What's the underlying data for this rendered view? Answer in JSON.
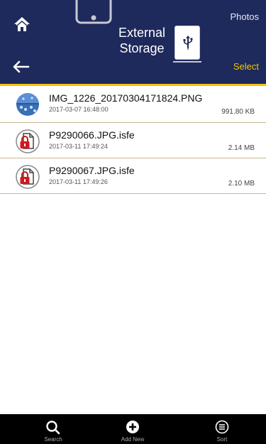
{
  "header": {
    "title": "External\nStorage",
    "photos_label": "Photos",
    "select_label": "Select",
    "accent_color": "#f2c500",
    "background_color": "#1e2a5c"
  },
  "files": [
    {
      "name": "IMG_1226_20170304171824.PNG",
      "date": "2017-03-07 16:48:00",
      "size": "991.80 KB",
      "icon": "image-thumbnail-icon"
    },
    {
      "name": "P9290066.JPG.isfe",
      "date": "2017-03-11 17:49:24",
      "size": "2.14 MB",
      "icon": "locked-document-icon"
    },
    {
      "name": "P9290067.JPG.isfe",
      "date": "2017-03-11 17:49:26",
      "size": "2.10 MB",
      "icon": "locked-document-icon"
    }
  ],
  "bottom_bar": {
    "search_label": "Search",
    "add_label": "Add New",
    "sort_label": "Sort"
  }
}
